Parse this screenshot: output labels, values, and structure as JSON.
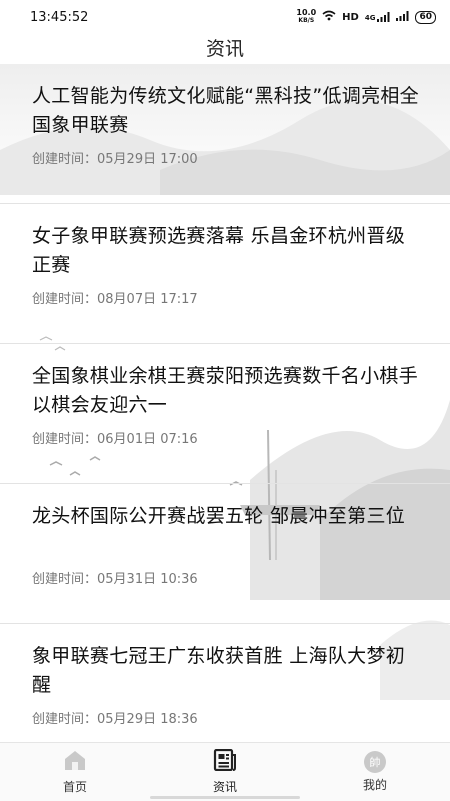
{
  "status": {
    "time": "13:45:52",
    "speed": "10.0",
    "speed_unit": "KB/S",
    "hd_label": "HD",
    "net_label": "4G",
    "battery": "60"
  },
  "header": {
    "title": "资讯"
  },
  "news": [
    {
      "title": "人工智能为传统文化赋能“黑科技”低调亮相全国象甲联赛",
      "time": "创建时间：05月29日 17:00"
    },
    {
      "title": "女子象甲联赛预选赛落幕 乐昌金环杭州晋级正赛",
      "time": "创建时间：08月07日 17:17"
    },
    {
      "title": "全国象棋业余棋王赛荥阳预选赛数千名小棋手以棋会友迎六一",
      "time": "创建时间：06月01日 07:16"
    },
    {
      "title": "龙头杯国际公开赛战罢五轮 邹晨冲至第三位",
      "time": "创建时间：05月31日 10:36"
    },
    {
      "title": "象甲联赛七冠王广东收获首胜 上海队大梦初醒",
      "time": "创建时间：05月29日 18:36"
    }
  ],
  "tabbar": {
    "home": {
      "label": "首页",
      "icon": "home-icon"
    },
    "news": {
      "label": "资讯",
      "icon": "newspaper-icon"
    },
    "me": {
      "label": "我的",
      "icon": "shuai-chess-piece-icon",
      "glyph": "帥"
    }
  },
  "colors": {
    "accent": "#333333",
    "divider": "#e3e3e3",
    "time_text": "#777777"
  }
}
